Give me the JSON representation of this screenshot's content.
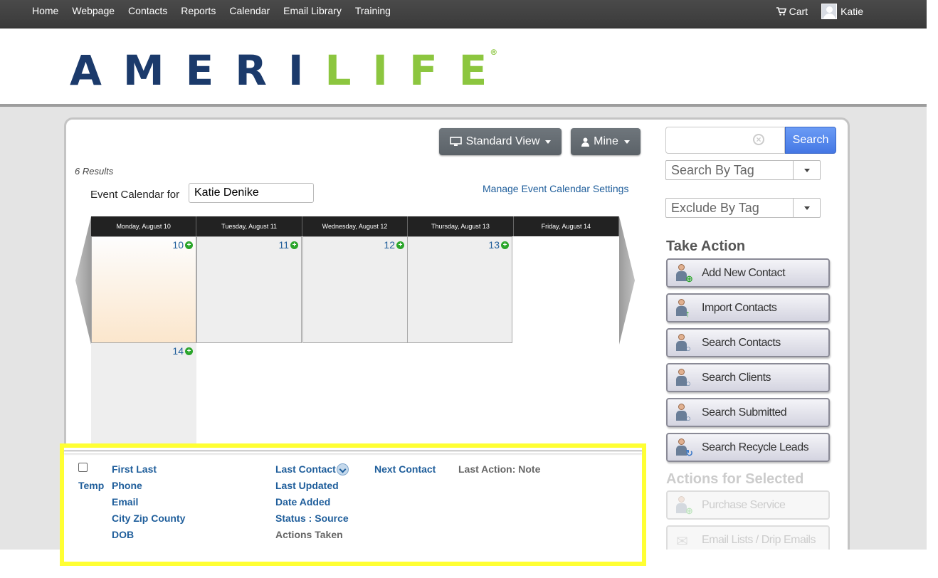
{
  "nav": {
    "links": [
      "Home",
      "Webpage",
      "Contacts",
      "Reports",
      "Calendar",
      "Email Library",
      "Training"
    ],
    "cart": "Cart",
    "user": "Katie"
  },
  "logo": {
    "part1": "AMERI",
    "part2": "LIFE",
    "reg": "®"
  },
  "toolbar": {
    "view": "Standard View",
    "filter": "Mine"
  },
  "results_count": "6 Results",
  "event_calendar": {
    "label": "Event Calendar for",
    "value": "Katie Denike",
    "manage_link": "Manage Event Calendar Settings"
  },
  "calendar": {
    "headers": [
      "Monday, August 10",
      "Tuesday, August 11",
      "Wednesday, August 12",
      "Thursday, August 13",
      "Friday, August 14"
    ],
    "days": [
      "10",
      "11",
      "12",
      "13",
      "14"
    ],
    "plus": "+"
  },
  "columns": {
    "temp": "Temp",
    "col1": [
      "First Last",
      "Phone",
      "Email",
      "City Zip County",
      "DOB"
    ],
    "col2": [
      "Last Contact",
      "Last Updated",
      "Date Added",
      "Status : Source",
      "Actions Taken"
    ],
    "col3": "Next Contact",
    "col4": "Last Action: Note"
  },
  "sidebar": {
    "search_button": "Search",
    "clear": "×",
    "search_by_tag": "Search By Tag",
    "exclude_by_tag": "Exclude By Tag",
    "take_action": "Take Action",
    "actions": [
      "Add New Contact",
      "Import Contacts",
      "Search Contacts",
      "Search Clients",
      "Search Submitted",
      "Search Recycle Leads"
    ],
    "actions_selected": "Actions for Selected",
    "selected_actions": [
      "Purchase Service",
      "Email Lists / Drip Emails"
    ]
  }
}
